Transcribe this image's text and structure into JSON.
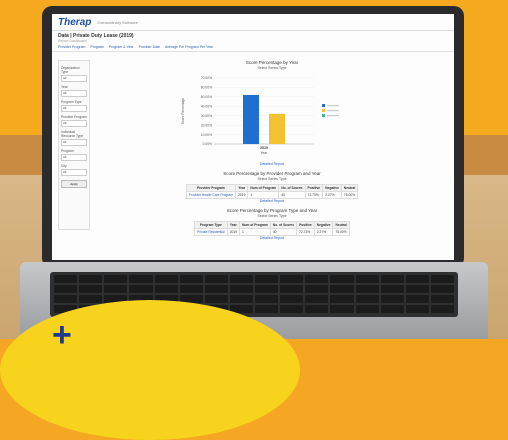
{
  "app": {
    "logo": "Therap",
    "tagline": "Extraordinary Software",
    "page_title": "Data | Private Duty Lease (2019)",
    "subtitle": "Report Dashboard",
    "tabs": [
      "Provider Program",
      "Program",
      "Program & Year",
      "Provider Date",
      "Average Per Program Per Year"
    ]
  },
  "sidebar": {
    "items": [
      {
        "label": "Organization Type",
        "value": "All"
      },
      {
        "label": "Year",
        "value": "All"
      },
      {
        "label": "Program Type",
        "value": "All"
      },
      {
        "label": "Provider Program",
        "value": "All"
      },
      {
        "label": "Individual Resource Type",
        "value": "All"
      },
      {
        "label": "Program",
        "value": "All"
      },
      {
        "label": "City",
        "value": "All"
      }
    ],
    "apply_label": "Apply"
  },
  "chart_section": {
    "title": "Score Percentage by Year",
    "select": "Select Series Type",
    "link": "Detailed Report"
  },
  "chart_data": {
    "type": "bar",
    "categories": [
      "2019"
    ],
    "series": [
      {
        "name": "",
        "values": [
          52
        ],
        "color": "#1f6fd1"
      },
      {
        "name": "",
        "values": [
          32
        ],
        "color": "#f2c230"
      }
    ],
    "ylim": [
      0,
      70
    ],
    "yticks": [
      "0.00%",
      "10.00%",
      "20.00%",
      "30.00%",
      "40.00%",
      "50.00%",
      "60.00%",
      "70.00%"
    ],
    "ylabel": "Score Percentage",
    "xlabel": "Year",
    "legend": [
      "",
      "",
      ""
    ]
  },
  "table1": {
    "title": "Score Percentage by Provider Program and Year",
    "select": "Select Series Type",
    "headers": [
      "Provider Program",
      "Year",
      "Num of Program",
      "No. of Scores",
      "Positive",
      "Negative",
      "Neutral"
    ],
    "rows": [
      [
        "Provider Health Care Program",
        "2019",
        "1",
        "40",
        "72.73%",
        "2.27%",
        "75.00%"
      ]
    ],
    "link": "Detailed Report"
  },
  "table2": {
    "title": "Score Percentage by Program Type and Year",
    "select": "Select Series Type",
    "headers": [
      "Program Type",
      "Year",
      "Num of Program",
      "No. of Scores",
      "Positive",
      "Negative",
      "Neutral"
    ],
    "rows": [
      [
        "Private Residential",
        "2019",
        "1",
        "40",
        "72.73%",
        "2.27%",
        "75.00%"
      ]
    ],
    "link": "Detailed Report"
  },
  "promo": {
    "glyph": "+"
  }
}
